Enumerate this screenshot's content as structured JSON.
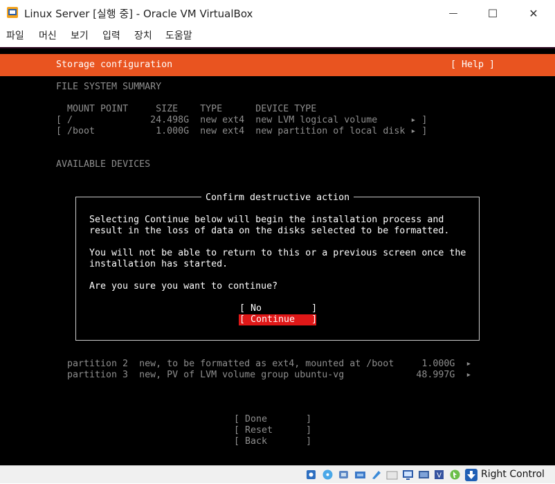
{
  "window": {
    "title": "Linux Server [실행 중] - Oracle VM VirtualBox",
    "minimize_glyph": "—",
    "maximize_glyph": "☐",
    "close_glyph": "✕"
  },
  "menu": [
    "파일",
    "머신",
    "보기",
    "입력",
    "장치",
    "도움말"
  ],
  "screen": {
    "header_title": "Storage configuration",
    "header_help": "[ Help ]",
    "fs_summary_heading": "FILE SYSTEM SUMMARY",
    "fs_columns": "  MOUNT POINT     SIZE    TYPE      DEVICE TYPE",
    "fs_rows": [
      "[ /              24.498G  new ext4  new LVM logical volume      ▸ ]",
      "[ /boot           1.000G  new ext4  new partition of local disk ▸ ]"
    ],
    "available_devices_heading": "AVAILABLE DEVICES",
    "dialog": {
      "title": "Confirm destructive action",
      "line1": "Selecting Continue below will begin the installation process and",
      "line2": "result in the loss of data on the disks selected to be formatted.",
      "line3": "You will not be able to return to this or a previous screen once the",
      "line4": "installation has started.",
      "question": "Are you sure you want to continue?",
      "no_button": "[ No         ]",
      "continue_button": "[ Continue   ]"
    },
    "partitions": [
      "partition 2  new, to be formatted as ext4, mounted at /boot     1.000G  ▸",
      "partition 3  new, PV of LVM volume group ubuntu-vg             48.997G  ▸"
    ],
    "bottom_buttons": [
      "[ Done       ]",
      "[ Reset      ]",
      "[ Back       ]"
    ]
  },
  "statusbar": {
    "icons": [
      "disk-icon",
      "optical-icon",
      "audio-icon",
      "network-icon",
      "usb-icon",
      "shared-folder-icon",
      "display-icon",
      "recording-icon",
      "cpu-icon",
      "mouse-integration-icon",
      "keyboard-icon"
    ],
    "host_key_label": "Right Control"
  },
  "colors": {
    "ubuntu_orange": "#e95420",
    "focus_red": "#e01818",
    "terminal_bg": "#000000"
  }
}
